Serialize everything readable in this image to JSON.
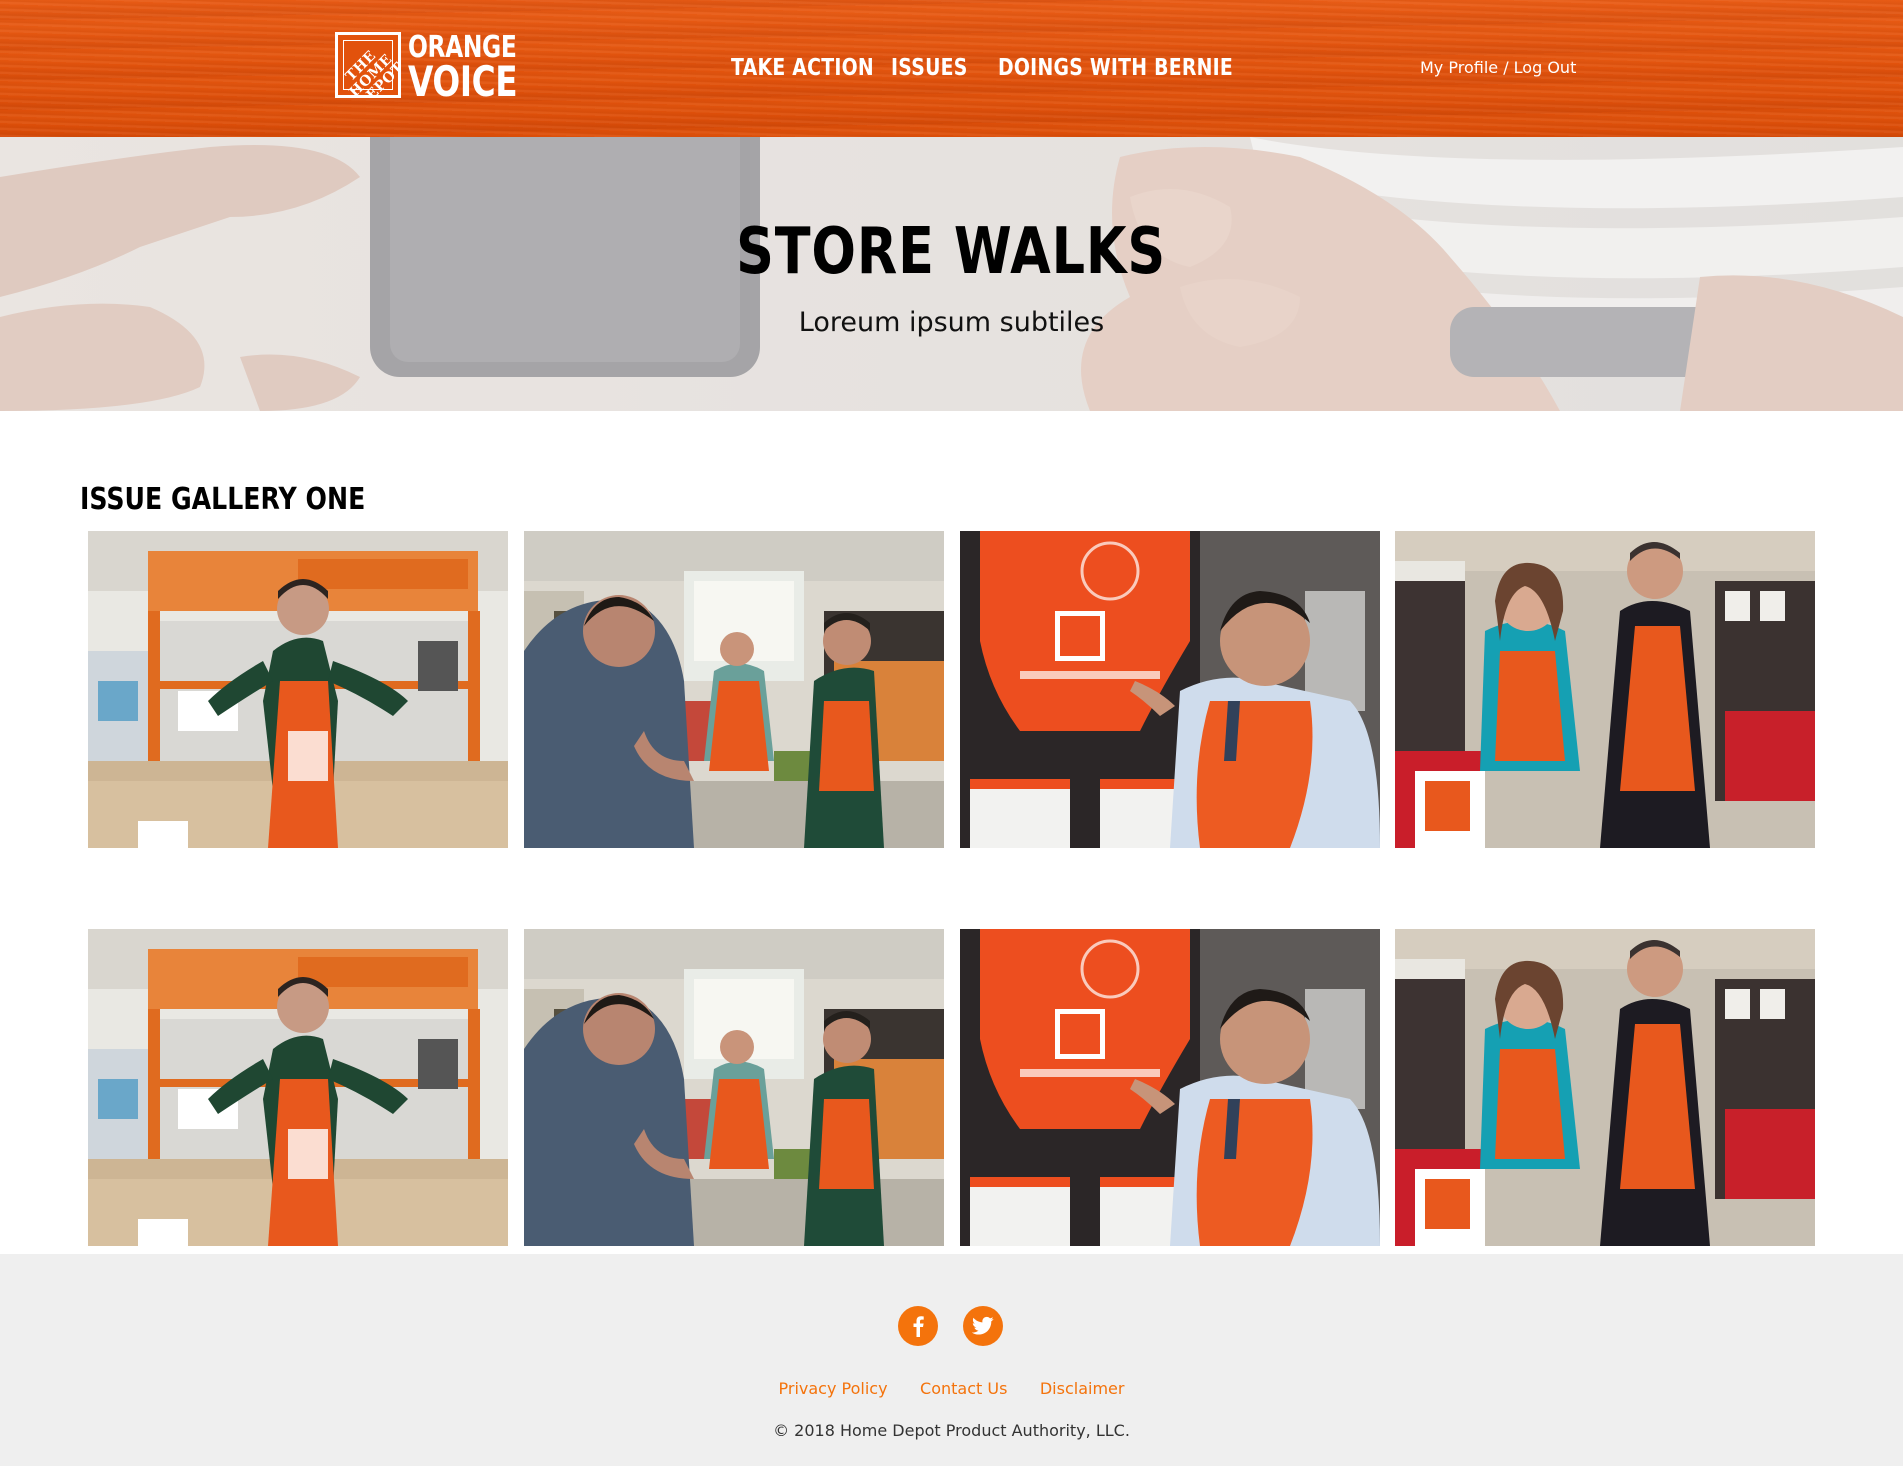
{
  "header": {
    "logo": {
      "badge_text": "THE HOME DEPOT",
      "word_top": "ORANGE",
      "word_bottom": "VOICE"
    },
    "nav": [
      {
        "label": "TAKE ACTION"
      },
      {
        "label": "ISSUES"
      },
      {
        "label": "DOINGS WITH BERNIE"
      }
    ],
    "profile_link": "My Profile / Log Out"
  },
  "hero": {
    "title": "STORE WALKS",
    "subtitle": "Loreum ipsum subtiles"
  },
  "gallery": {
    "title": "ISSUE GALLERY ONE",
    "rows": [
      [
        "store-walk-photo-1",
        "store-walk-photo-2",
        "store-walk-photo-3",
        "store-walk-photo-4"
      ],
      [
        "store-walk-photo-1",
        "store-walk-photo-2",
        "store-walk-photo-3",
        "store-walk-photo-4"
      ]
    ]
  },
  "footer": {
    "social": [
      {
        "icon": "facebook-icon"
      },
      {
        "icon": "twitter-icon"
      }
    ],
    "links": [
      {
        "label": "Privacy Policy"
      },
      {
        "label": "Contact Us"
      },
      {
        "label": "Disclaimer"
      }
    ],
    "copyright": "© 2018 Home Depot Product Authority, LLC."
  },
  "colors": {
    "brand_orange": "#e2520c",
    "link_orange": "#f4730c",
    "footer_bg": "#efefef"
  }
}
